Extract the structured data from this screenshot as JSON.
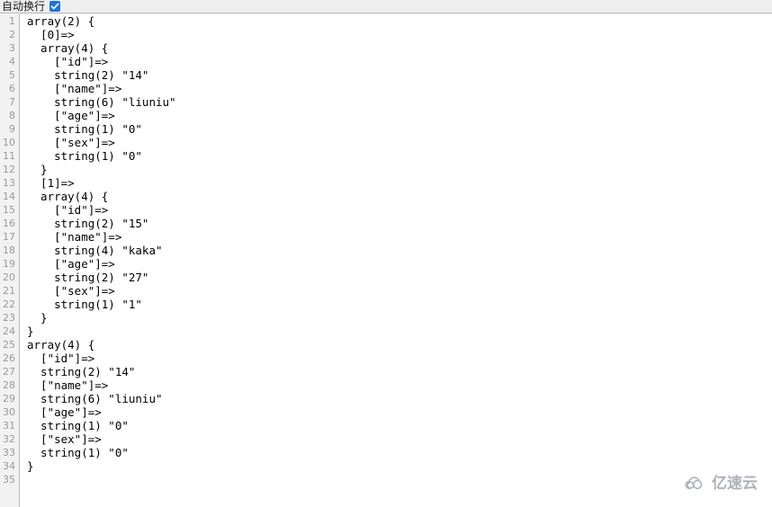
{
  "header": {
    "wrap_label": "自动换行",
    "wrap_checked": true,
    "checkbox_color": "#1a73e8",
    "check_icon": "check-icon",
    "background_color": "#efefef"
  },
  "editor": {
    "gutter_background": "#f2f2f2",
    "gutter_text_color": "#9a9a9a",
    "code_text_color": "#000000",
    "background_color": "#ffffff",
    "total_lines": 35,
    "line_numbers": [
      1,
      2,
      3,
      4,
      5,
      6,
      7,
      8,
      9,
      10,
      11,
      12,
      13,
      14,
      15,
      16,
      17,
      18,
      19,
      20,
      21,
      22,
      23,
      24,
      25,
      26,
      27,
      28,
      29,
      30,
      31,
      32,
      33,
      34,
      35
    ],
    "lines": [
      "array(2) {",
      "  [0]=>",
      "  array(4) {",
      "    [\"id\"]=>",
      "    string(2) \"14\"",
      "    [\"name\"]=>",
      "    string(6) \"liuniu\"",
      "    [\"age\"]=>",
      "    string(1) \"0\"",
      "    [\"sex\"]=>",
      "    string(1) \"0\"",
      "  }",
      "  [1]=>",
      "  array(4) {",
      "    [\"id\"]=>",
      "    string(2) \"15\"",
      "    [\"name\"]=>",
      "    string(4) \"kaka\"",
      "    [\"age\"]=>",
      "    string(2) \"27\"",
      "    [\"sex\"]=>",
      "    string(1) \"1\"",
      "  }",
      "}",
      "array(4) {",
      "  [\"id\"]=>",
      "  string(2) \"14\"",
      "  [\"name\"]=>",
      "  string(6) \"liuniu\"",
      "  [\"age\"]=>",
      "  string(1) \"0\"",
      "  [\"sex\"]=>",
      "  string(1) \"0\"",
      "}",
      ""
    ]
  },
  "watermark": {
    "text": "亿速云",
    "icon": "cloud-icon",
    "color": "#a9adb8"
  }
}
